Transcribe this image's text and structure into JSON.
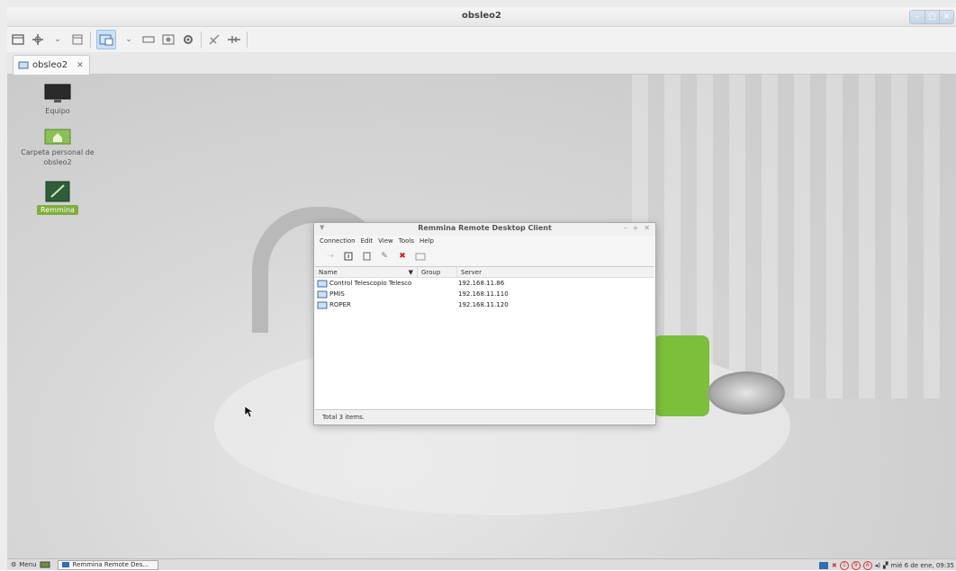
{
  "window": {
    "title": "obsleo2"
  },
  "tab": {
    "label": "obsleo2"
  },
  "desktop_icons": [
    {
      "label": "Equipo"
    },
    {
      "label": "Carpeta personal de obsleo2"
    },
    {
      "label": "Remmina"
    }
  ],
  "remmina": {
    "title": "Remmina Remote Desktop Client",
    "menu": [
      "Connection",
      "Edit",
      "View",
      "Tools",
      "Help"
    ],
    "columns": [
      "Name",
      "Group",
      "Server"
    ],
    "rows": [
      {
        "name": "Control Telescopio Telesco",
        "group": "",
        "server": "192.168.11.86"
      },
      {
        "name": "PMIS",
        "group": "",
        "server": "192.168.11.110"
      },
      {
        "name": "ROPER",
        "group": "",
        "server": "192.168.11.120"
      }
    ],
    "status": "Total 3 items."
  },
  "panel": {
    "menu_label": "Menu",
    "task_label": "Remmina Remote Des...",
    "clock": "mié  6 de ene, 09:35",
    "indicators": [
      "1",
      "9",
      "A"
    ]
  },
  "colors": {
    "accent": "#7fae3c",
    "mint_green": "#7bbf3a"
  }
}
